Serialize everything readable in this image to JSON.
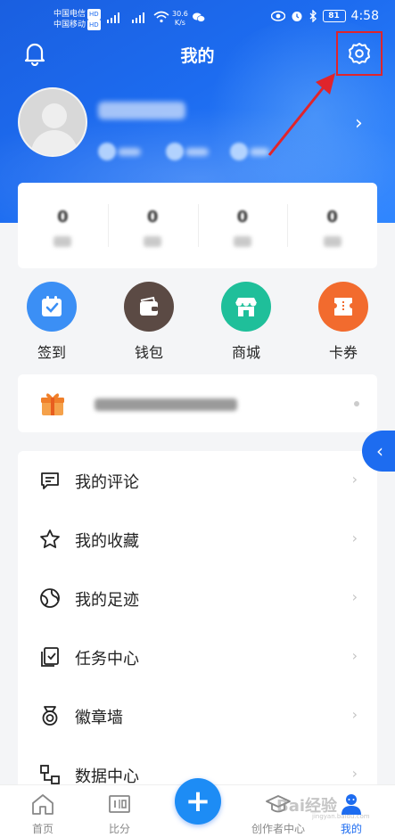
{
  "status_bar": {
    "carrier1": "中国电信",
    "carrier2": "中国移动",
    "hd": "HD",
    "net_speed_value": "30.6",
    "net_speed_unit": "K/s",
    "battery": "81",
    "time": "4:58"
  },
  "header": {
    "title": "我的"
  },
  "profile": {
    "chevron": "›"
  },
  "stats": [
    {
      "value": "0"
    },
    {
      "value": "0"
    },
    {
      "value": "0"
    },
    {
      "value": "0"
    }
  ],
  "quick_actions": [
    {
      "label": "签到",
      "color": "#3b8ff5",
      "icon": "calendar-check-icon"
    },
    {
      "label": "钱包",
      "color": "#5b4a44",
      "icon": "wallet-icon"
    },
    {
      "label": "商城",
      "color": "#1fbf9a",
      "icon": "store-icon"
    },
    {
      "label": "卡券",
      "color": "#f26b2e",
      "icon": "ticket-icon"
    }
  ],
  "side_tab": {
    "label": "‹"
  },
  "menu": [
    {
      "label": "我的评论",
      "icon": "comment-icon"
    },
    {
      "label": "我的收藏",
      "icon": "star-icon"
    },
    {
      "label": "我的足迹",
      "icon": "footprint-icon"
    },
    {
      "label": "任务中心",
      "icon": "task-icon"
    },
    {
      "label": "徽章墙",
      "icon": "medal-icon"
    },
    {
      "label": "数据中心",
      "icon": "data-icon"
    }
  ],
  "menu_chevron": "›",
  "bottom_nav": [
    {
      "label": "首页",
      "icon": "home-icon",
      "active": false
    },
    {
      "label": "比分",
      "icon": "scoreboard-icon",
      "active": false
    },
    {
      "label": "创作者中心",
      "icon": "graduation-cap-icon",
      "active": false
    },
    {
      "label": "我的",
      "icon": "profile-icon",
      "active": true
    }
  ],
  "fab": {
    "label": "+"
  },
  "watermark": {
    "text": "Bai经验",
    "sub": "jingyan.baidu.com"
  },
  "colors": {
    "accent": "#1d6cf0",
    "highlight_box": "#e0242b"
  }
}
